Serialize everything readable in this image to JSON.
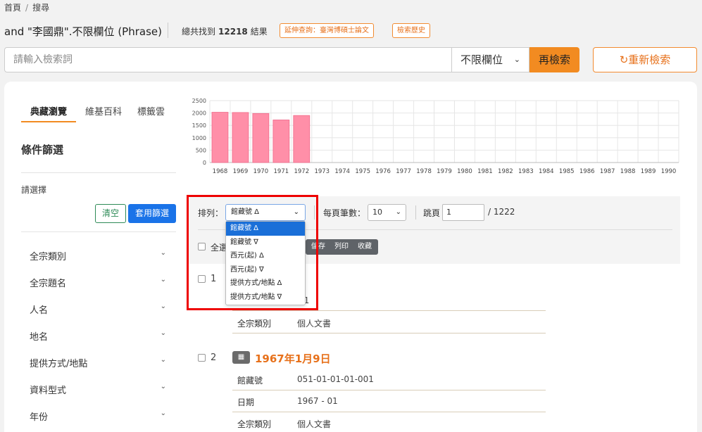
{
  "breadcrumb": {
    "home": "首頁",
    "separator": "/",
    "current": "搜尋"
  },
  "query": {
    "title": "and \"李國鼎\".不限欄位 (Phrase)",
    "total_prefix": "總共找到",
    "total_count": "12218",
    "total_suffix": "結果",
    "extend_button": "延伸查詢：臺灣博碩士論文",
    "history_button": "檢索歷史"
  },
  "search": {
    "placeholder": "請輸入檢索詞",
    "field_select": "不限欄位",
    "search_button": "再檢索",
    "reset_button": "重新檢索"
  },
  "sidebar": {
    "tabs": [
      {
        "label": "典藏瀏覽",
        "active": true
      },
      {
        "label": "維基百科",
        "active": false
      },
      {
        "label": "標籤雲",
        "active": false
      }
    ],
    "filter_title": "條件篩選",
    "choose_label": "請選擇",
    "clear_button": "清空",
    "apply_button": "套用篩選",
    "facets": [
      "全宗類別",
      "全宗題名",
      "人名",
      "地名",
      "提供方式/地點",
      "資料型式",
      "年份"
    ]
  },
  "chart_data": {
    "type": "bar",
    "categories": [
      "1968",
      "1969",
      "1970",
      "1971",
      "1972",
      "1973",
      "1974",
      "1975",
      "1976",
      "1977",
      "1978",
      "1979",
      "1980",
      "1981",
      "1982",
      "1983",
      "1984",
      "1985",
      "1986",
      "1987",
      "1988",
      "1989",
      "1990"
    ],
    "values": [
      2030,
      2020,
      1980,
      1720,
      1900,
      0,
      0,
      0,
      0,
      0,
      0,
      0,
      0,
      0,
      0,
      0,
      0,
      0,
      0,
      0,
      0,
      0,
      0
    ],
    "yticks": [
      0,
      500,
      1000,
      1500,
      2000,
      2500
    ],
    "ylim": [
      0,
      2500
    ],
    "title": "",
    "xlabel": "",
    "ylabel": "",
    "color": "#ff8fa8",
    "grid": true
  },
  "toolbar": {
    "sort_label": "排列：",
    "sort_selected": "館藏號 Δ",
    "sort_options": [
      "館藏號 Δ",
      "館藏號 ∇",
      "西元(起) Δ",
      "西元(起) ∇",
      "提供方式/地點 Δ",
      "提供方式/地點 ∇"
    ],
    "per_page_label": "每頁筆數：",
    "per_page_value": "10",
    "jump_label": "跳頁",
    "jump_value": "1",
    "page_total": "/ 1222",
    "select_all": "全選",
    "actions": [
      "儲存",
      "列印",
      "收藏"
    ]
  },
  "records": [
    {
      "num": "1",
      "partial_value": "51",
      "fields": [
        {
          "key": "全宗類別",
          "value": "個人文書"
        }
      ]
    },
    {
      "num": "2",
      "title": "1967年1月9日",
      "icon": "archive-icon",
      "fields": [
        {
          "key": "館藏號",
          "value": "051-01-01-01-001"
        },
        {
          "key": "日期",
          "value": "1967 - 01"
        },
        {
          "key": "全宗類別",
          "value": "個人文書"
        }
      ]
    }
  ],
  "colors": {
    "accent": "#f28b21",
    "primary": "#1a73e8",
    "highlight": "#e00000"
  }
}
